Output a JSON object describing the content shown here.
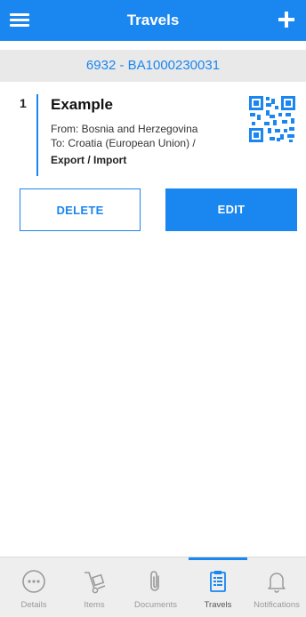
{
  "header": {
    "title": "Travels",
    "menu_icon": "hamburger-menu-icon",
    "add_icon": "plus-icon",
    "accent": "#1a86f0"
  },
  "subheader": {
    "declaration": "6932 - BA1000230031"
  },
  "travel": {
    "number": "1",
    "name": "Example",
    "from": "From: Bosnia and Herzegovina",
    "to": "To: Croatia (European Union) /",
    "type": "Export / Import",
    "qr_icon": "qr-code-icon"
  },
  "actions": {
    "delete_label": "DELETE",
    "edit_label": "EDIT"
  },
  "bottom_nav": {
    "active": "Travels",
    "items": [
      {
        "label": "Details",
        "icon": "more-dots-icon"
      },
      {
        "label": "Items",
        "icon": "hand-truck-icon"
      },
      {
        "label": "Documents",
        "icon": "paperclip-icon"
      },
      {
        "label": "Travels",
        "icon": "clipboard-icon"
      },
      {
        "label": "Notifications",
        "icon": "bell-icon"
      }
    ]
  }
}
